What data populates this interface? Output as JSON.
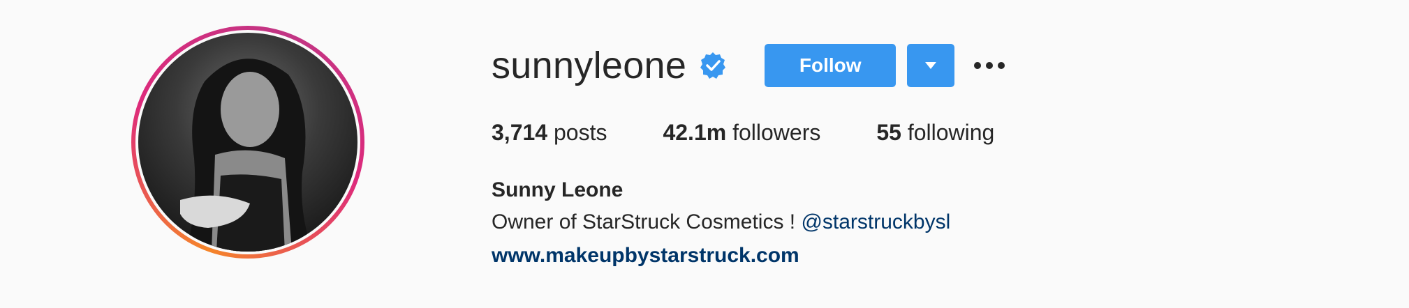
{
  "profile": {
    "username": "sunnyleone",
    "full_name": "Sunny Leone",
    "bio_text": "Owner of StarStruck Cosmetics ! ",
    "bio_mention": "@starstruckbysl",
    "website": "www.makeupbystarstruck.com",
    "avatar_icon": "profile-photo",
    "verified_icon": "verified-badge-icon"
  },
  "actions": {
    "follow_label": "Follow",
    "dropdown_icon": "caret-down-icon",
    "more_icon": "more-options-icon"
  },
  "stats": [
    {
      "value": "3,714",
      "label": " posts"
    },
    {
      "value": "42.1m",
      "label": " followers"
    },
    {
      "value": "55",
      "label": " following"
    }
  ],
  "colors": {
    "accent": "#3897f0",
    "link": "#003569",
    "text": "#262626",
    "background": "#fafafa"
  }
}
